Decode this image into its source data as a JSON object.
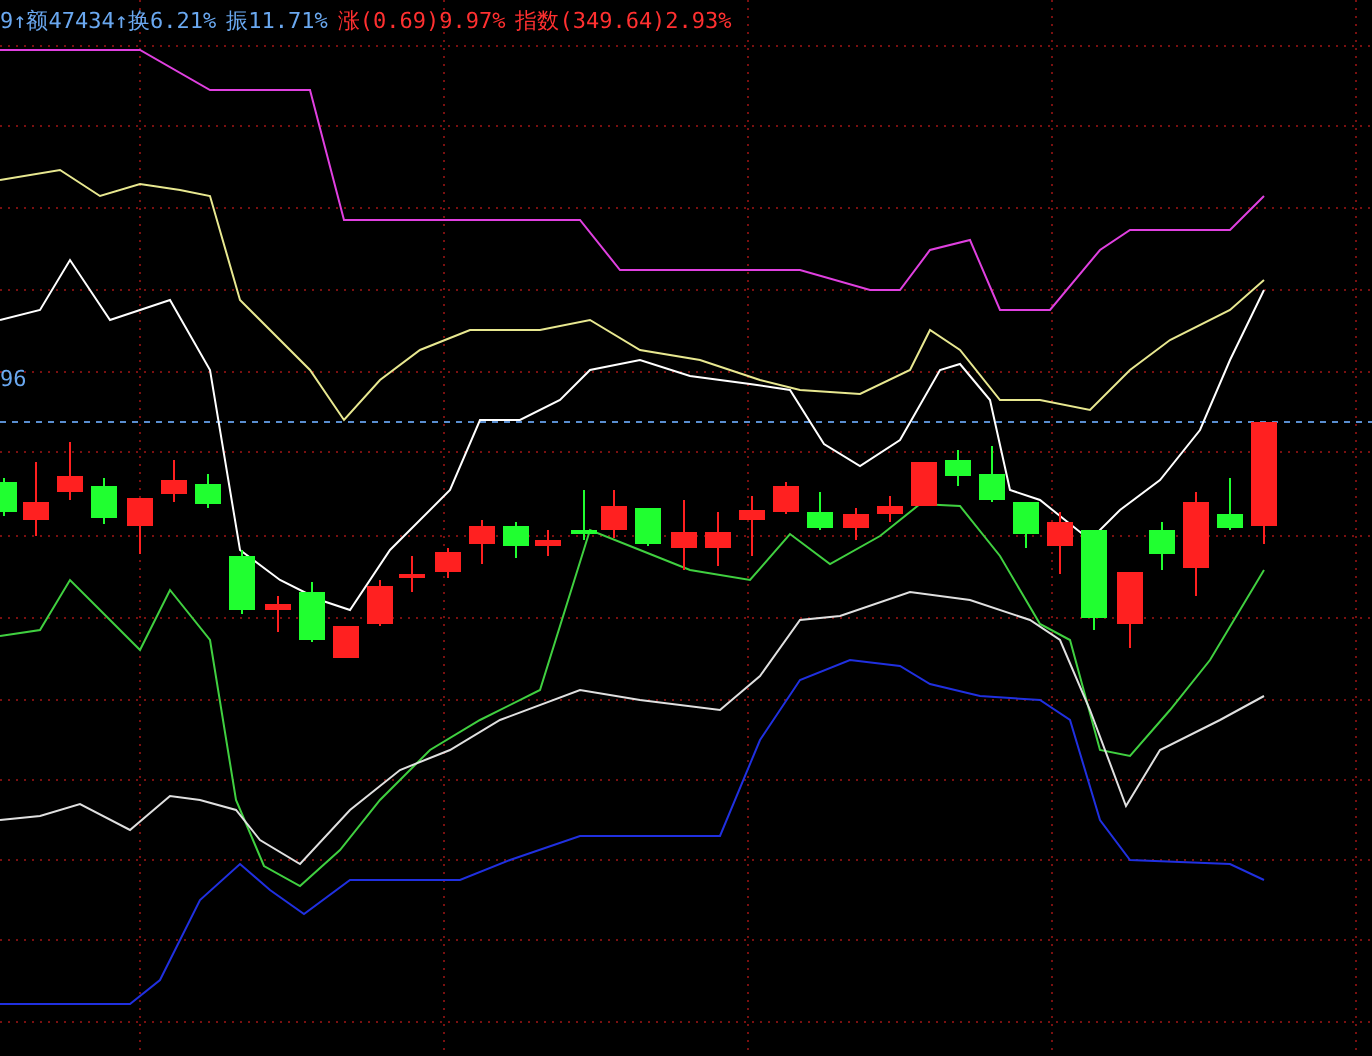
{
  "stats_bar": {
    "items": [
      {
        "text": "9↑额47434↑换6.21%",
        "kind": "info"
      },
      {
        "text": "振11.71%",
        "kind": "info"
      },
      {
        "text": "涨(0.69)9.97%",
        "kind": "rise"
      },
      {
        "text": "指数(349.64)2.93%",
        "kind": "rise"
      }
    ]
  },
  "axis_label": "96"
}
